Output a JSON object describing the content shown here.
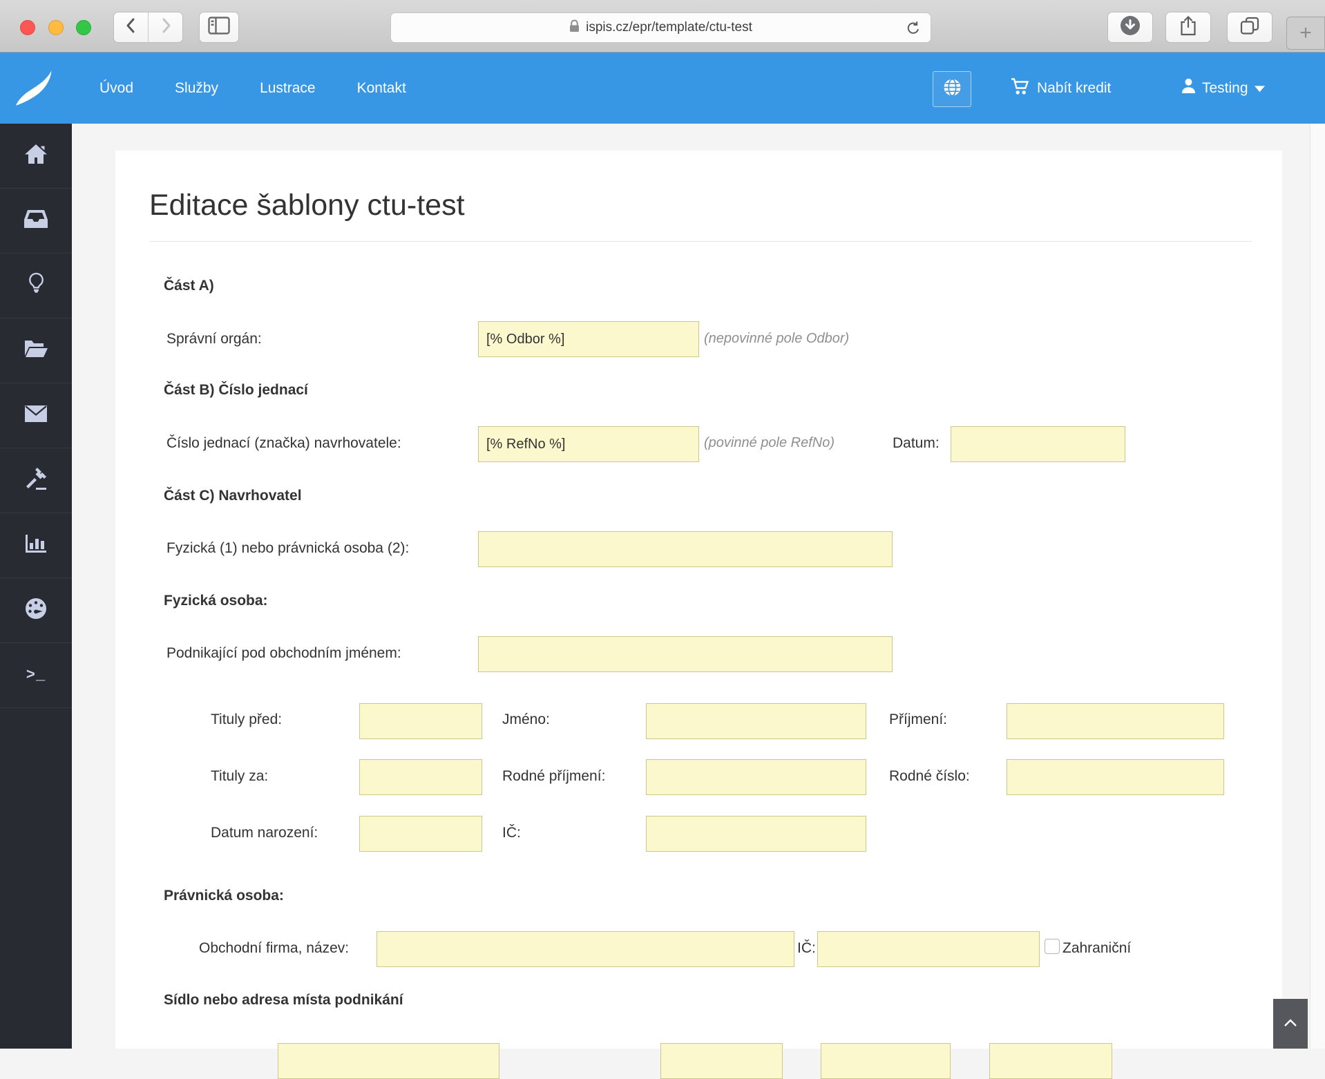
{
  "browser": {
    "url": "ispis.cz/epr/template/ctu-test",
    "new_tab_glyph": "+",
    "traffic_lights": {
      "close": "#fc5753",
      "minimize": "#fdbc40",
      "zoom": "#33c748"
    }
  },
  "navbar": {
    "background": "#3797e4",
    "links": [
      "Úvod",
      "Služby",
      "Lustrace",
      "Kontakt"
    ],
    "credit_label": "Nabít kredit",
    "user_label": "Testing"
  },
  "sidebar": {
    "icons": [
      "home-icon",
      "inbox-icon",
      "lightbulb-icon",
      "folder-open-icon",
      "envelope-icon",
      "gavel-icon",
      "bar-chart-icon",
      "dashboard-icon",
      "terminal-icon"
    ],
    "terminal_glyph": ">_"
  },
  "form": {
    "title": "Editace šablony ctu-test",
    "input_bg": "#fcf8cd",
    "part_a_heading": "Část A)",
    "spravni_organ_label": "Správní orgán:",
    "spravni_organ_value": "[% Odbor %]",
    "spravni_organ_note": "(nepovinné pole Odbor)",
    "part_b_heading": "Část B) Číslo jednací",
    "cislo_jednaci_label": "Číslo jednací (značka) navrhovatele:",
    "cislo_jednaci_value": "[% RefNo %]",
    "cislo_jednaci_note": "(povinné pole RefNo)",
    "datum_label": "Datum:",
    "part_c_heading": "Část C) Navrhovatel",
    "osoba_typ_label": "Fyzická (1) nebo právnická osoba (2):",
    "fyzicka_heading": "Fyzická osoba:",
    "podnikajici_label": "Podnikající pod obchodním jménem:",
    "tituly_pred_label": "Tituly před:",
    "jmeno_label": "Jméno:",
    "prijmeni_label": "Příjmení:",
    "tituly_za_label": "Tituly za:",
    "rodne_prijmeni_label": "Rodné příjmení:",
    "rodne_cislo_label": "Rodné číslo:",
    "datum_narozeni_label": "Datum narození:",
    "ic_label": "IČ:",
    "pravnicka_heading": "Právnická osoba:",
    "obchodni_firma_label": "Obchodní firma, název:",
    "ic2_label": "IČ:",
    "zahranicni_label": "Zahraniční",
    "sidlo_heading": "Sídlo nebo adresa místa podnikání"
  }
}
